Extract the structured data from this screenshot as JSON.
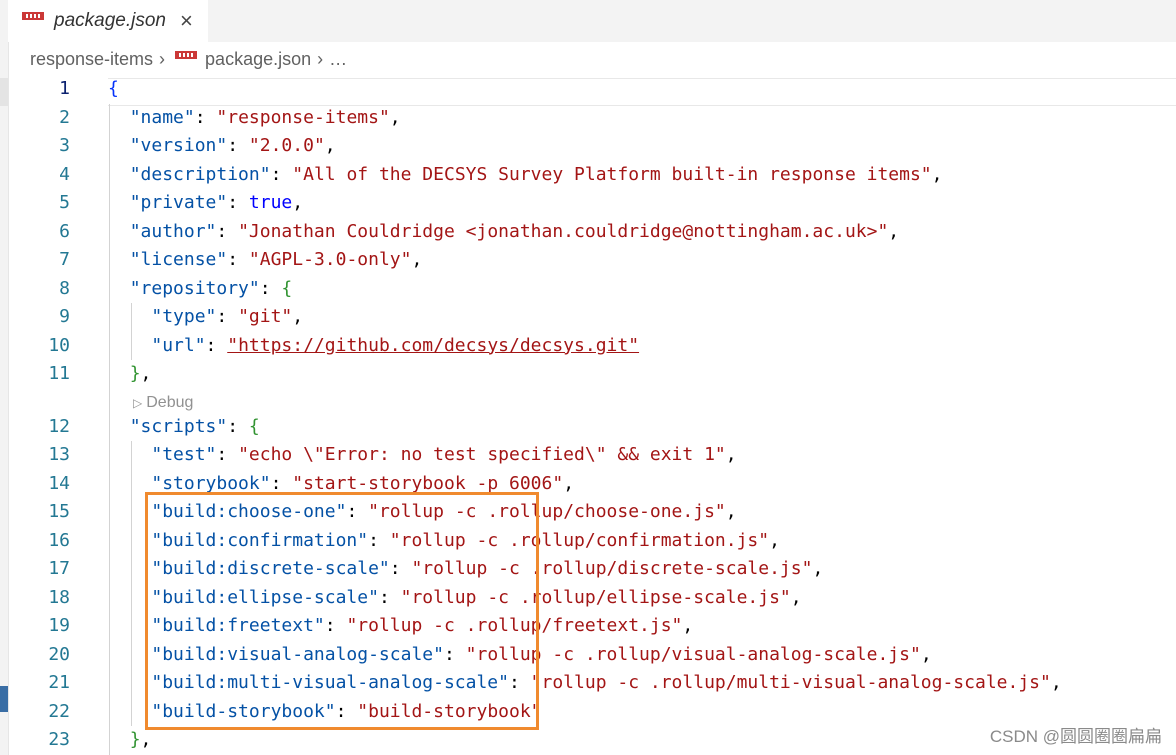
{
  "tab": {
    "title": "package.json",
    "close_icon": "×",
    "file_icon": "npm-icon"
  },
  "breadcrumb": {
    "folder": "response-items",
    "file": "package.json",
    "more": "…",
    "separator": "›"
  },
  "codelens": {
    "label": "Debug"
  },
  "watermark": "CSDN @圆圆圈圈扁扁",
  "lines": [
    {
      "n": "1",
      "tokens": [
        {
          "t": "{",
          "c": "brace"
        }
      ]
    },
    {
      "n": "2",
      "tokens": [
        {
          "t": "  "
        },
        {
          "t": "\"name\"",
          "c": "k"
        },
        {
          "t": ": "
        },
        {
          "t": "\"response-items\"",
          "c": "s"
        },
        {
          "t": ","
        }
      ]
    },
    {
      "n": "3",
      "tokens": [
        {
          "t": "  "
        },
        {
          "t": "\"version\"",
          "c": "k"
        },
        {
          "t": ": "
        },
        {
          "t": "\"2.0.0\"",
          "c": "s"
        },
        {
          "t": ","
        }
      ]
    },
    {
      "n": "4",
      "tokens": [
        {
          "t": "  "
        },
        {
          "t": "\"description\"",
          "c": "k"
        },
        {
          "t": ": "
        },
        {
          "t": "\"All of the DECSYS Survey Platform built-in response items\"",
          "c": "s"
        },
        {
          "t": ","
        }
      ]
    },
    {
      "n": "5",
      "tokens": [
        {
          "t": "  "
        },
        {
          "t": "\"private\"",
          "c": "k"
        },
        {
          "t": ": "
        },
        {
          "t": "true",
          "c": "b"
        },
        {
          "t": ","
        }
      ]
    },
    {
      "n": "6",
      "tokens": [
        {
          "t": "  "
        },
        {
          "t": "\"author\"",
          "c": "k"
        },
        {
          "t": ": "
        },
        {
          "t": "\"Jonathan Couldridge <jonathan.couldridge@nottingham.ac.uk>\"",
          "c": "s"
        },
        {
          "t": ","
        }
      ]
    },
    {
      "n": "7",
      "tokens": [
        {
          "t": "  "
        },
        {
          "t": "\"license\"",
          "c": "k"
        },
        {
          "t": ": "
        },
        {
          "t": "\"AGPL-3.0-only\"",
          "c": "s"
        },
        {
          "t": ","
        }
      ]
    },
    {
      "n": "8",
      "tokens": [
        {
          "t": "  "
        },
        {
          "t": "\"repository\"",
          "c": "k"
        },
        {
          "t": ": "
        },
        {
          "t": "{",
          "c": "brace2"
        }
      ]
    },
    {
      "n": "9",
      "tokens": [
        {
          "t": "    "
        },
        {
          "t": "\"type\"",
          "c": "k"
        },
        {
          "t": ": "
        },
        {
          "t": "\"git\"",
          "c": "s"
        },
        {
          "t": ","
        }
      ]
    },
    {
      "n": "10",
      "tokens": [
        {
          "t": "    "
        },
        {
          "t": "\"url\"",
          "c": "k"
        },
        {
          "t": ": "
        },
        {
          "t": "\"https://github.com/decsys/decsys.git\"",
          "c": "s url-link"
        }
      ]
    },
    {
      "n": "11",
      "tokens": [
        {
          "t": "  "
        },
        {
          "t": "}",
          "c": "brace2"
        },
        {
          "t": ","
        }
      ]
    },
    {
      "n": "12",
      "tokens": [
        {
          "t": "  "
        },
        {
          "t": "\"scripts\"",
          "c": "k"
        },
        {
          "t": ": "
        },
        {
          "t": "{",
          "c": "brace2"
        }
      ]
    },
    {
      "n": "13",
      "tokens": [
        {
          "t": "    "
        },
        {
          "t": "\"test\"",
          "c": "k"
        },
        {
          "t": ": "
        },
        {
          "t": "\"echo \\\"Error: no test specified\\\" && exit 1\"",
          "c": "s"
        },
        {
          "t": ","
        }
      ]
    },
    {
      "n": "14",
      "tokens": [
        {
          "t": "    "
        },
        {
          "t": "\"storybook\"",
          "c": "k"
        },
        {
          "t": ": "
        },
        {
          "t": "\"start-storybook -p 6006\"",
          "c": "s"
        },
        {
          "t": ","
        }
      ]
    },
    {
      "n": "15",
      "tokens": [
        {
          "t": "    "
        },
        {
          "t": "\"build:choose-one\"",
          "c": "k"
        },
        {
          "t": ": "
        },
        {
          "t": "\"rollup -c .rollup/choose-one.js\"",
          "c": "s"
        },
        {
          "t": ","
        }
      ]
    },
    {
      "n": "16",
      "tokens": [
        {
          "t": "    "
        },
        {
          "t": "\"build:confirmation\"",
          "c": "k"
        },
        {
          "t": ": "
        },
        {
          "t": "\"rollup -c .rollup/confirmation.js\"",
          "c": "s"
        },
        {
          "t": ","
        }
      ]
    },
    {
      "n": "17",
      "tokens": [
        {
          "t": "    "
        },
        {
          "t": "\"build:discrete-scale\"",
          "c": "k"
        },
        {
          "t": ": "
        },
        {
          "t": "\"rollup -c .rollup/discrete-scale.js\"",
          "c": "s"
        },
        {
          "t": ","
        }
      ]
    },
    {
      "n": "18",
      "tokens": [
        {
          "t": "    "
        },
        {
          "t": "\"build:ellipse-scale\"",
          "c": "k"
        },
        {
          "t": ": "
        },
        {
          "t": "\"rollup -c .rollup/ellipse-scale.js\"",
          "c": "s"
        },
        {
          "t": ","
        }
      ]
    },
    {
      "n": "19",
      "tokens": [
        {
          "t": "    "
        },
        {
          "t": "\"build:freetext\"",
          "c": "k"
        },
        {
          "t": ": "
        },
        {
          "t": "\"rollup -c .rollup/freetext.js\"",
          "c": "s"
        },
        {
          "t": ","
        }
      ]
    },
    {
      "n": "20",
      "tokens": [
        {
          "t": "    "
        },
        {
          "t": "\"build:visual-analog-scale\"",
          "c": "k"
        },
        {
          "t": ": "
        },
        {
          "t": "\"rollup -c .rollup/visual-analog-scale.js\"",
          "c": "s"
        },
        {
          "t": ","
        }
      ]
    },
    {
      "n": "21",
      "tokens": [
        {
          "t": "    "
        },
        {
          "t": "\"build:multi-visual-analog-scale\"",
          "c": "k"
        },
        {
          "t": ": "
        },
        {
          "t": "\"rollup -c .rollup/multi-visual-analog-scale.js\"",
          "c": "s"
        },
        {
          "t": ","
        }
      ]
    },
    {
      "n": "22",
      "tokens": [
        {
          "t": "    "
        },
        {
          "t": "\"build-storybook\"",
          "c": "k"
        },
        {
          "t": ": "
        },
        {
          "t": "\"build-storybook\"",
          "c": "s"
        }
      ]
    },
    {
      "n": "23",
      "tokens": [
        {
          "t": "  "
        },
        {
          "t": "}",
          "c": "brace2"
        },
        {
          "t": ","
        }
      ]
    }
  ]
}
